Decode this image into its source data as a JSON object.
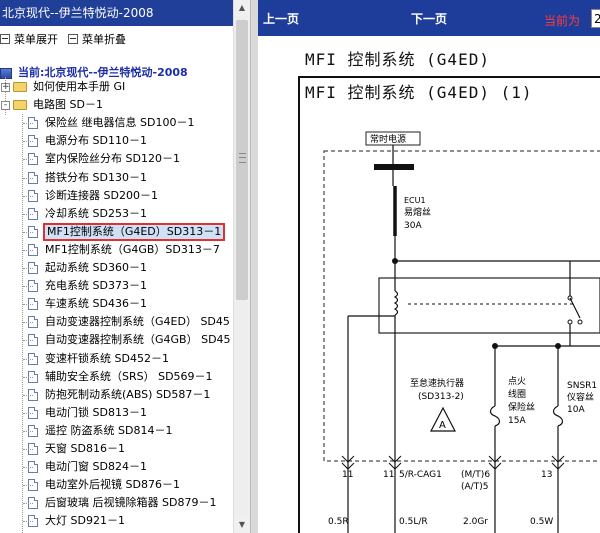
{
  "tree_panel": {
    "title": "北京现代--伊兰特悦动-2008",
    "tools": {
      "expand_label": "菜单展开",
      "collapse_label": "菜单折叠"
    },
    "root_label": "当前:北京现代--伊兰特悦动-2008",
    "items": [
      {
        "label": "如何使用本手册 GI",
        "kind": "folder",
        "state": "+"
      },
      {
        "label": "电路图 SD－1",
        "kind": "folder",
        "state": "-"
      },
      {
        "label": "保险丝 继电器信息 SD100－1",
        "kind": "doc"
      },
      {
        "label": "电源分布 SD110－1",
        "kind": "doc"
      },
      {
        "label": "室内保险丝分布 SD120－1",
        "kind": "doc"
      },
      {
        "label": "搭铁分布 SD130－1",
        "kind": "doc"
      },
      {
        "label": "诊断连接器 SD200－1",
        "kind": "doc"
      },
      {
        "label": "冷却系统 SD253－1",
        "kind": "doc"
      },
      {
        "label": "MF1控制系统（G4ED）SD313－1",
        "kind": "doc",
        "selected": true
      },
      {
        "label": "MF1控制系统（G4GB）SD313－7",
        "kind": "doc"
      },
      {
        "label": "起动系统 SD360－1",
        "kind": "doc"
      },
      {
        "label": "充电系统 SD373－1",
        "kind": "doc"
      },
      {
        "label": "车速系统 SD436－1",
        "kind": "doc"
      },
      {
        "label": "自动变速器控制系统（G4ED） SD45",
        "kind": "doc"
      },
      {
        "label": "自动变速器控制系统（G4GB） SD45",
        "kind": "doc"
      },
      {
        "label": "变速杆锁系统 SD452－1",
        "kind": "doc"
      },
      {
        "label": "辅助安全系统（SRS） SD569－1",
        "kind": "doc"
      },
      {
        "label": "防抱死制动系统(ABS) SD587－1",
        "kind": "doc"
      },
      {
        "label": "电动门锁 SD813－1",
        "kind": "doc"
      },
      {
        "label": "遥控 防盗系统 SD814－1",
        "kind": "doc"
      },
      {
        "label": "天窗 SD816－1",
        "kind": "doc"
      },
      {
        "label": "电动门窗 SD824－1",
        "kind": "doc"
      },
      {
        "label": "电动室外后视镜 SD876－1",
        "kind": "doc"
      },
      {
        "label": "后窗玻璃 后视镜除箱器 SD879－1",
        "kind": "doc"
      },
      {
        "label": "大灯 SD921－1",
        "kind": "doc"
      }
    ]
  },
  "nav": {
    "prev_label": "上一页",
    "next_label": "下一页",
    "current_label": "当前为",
    "page_value": "2"
  },
  "document": {
    "header": "MFI 控制系统 (G4ED)",
    "subtitle": "MFI 控制系统 (G4ED) (1)",
    "diagram": {
      "power_label": "常时电源",
      "fuse_main": [
        "ECU1",
        "易熔丝",
        "30A"
      ],
      "actuator_label": [
        "至怠速执行器",
        "(SD313-2)"
      ],
      "fuse_ign": [
        "点火",
        "线圈",
        "保险丝",
        "15A"
      ],
      "fuse_snsr": [
        "SNSR1",
        "仪容丝",
        "10A"
      ],
      "actuator_symbol": "A",
      "pins": [
        "11",
        "11",
        "5/R-CAG1",
        "(M/T)6",
        "(A/T)5",
        "13"
      ],
      "wires": [
        "0.5R",
        "0.5L/R",
        "2.0Gr",
        "0.5W"
      ]
    }
  },
  "colors": {
    "title_bar": "#1f3f99",
    "nav_bar": "#1e3d9a",
    "selection_border": "#e03131",
    "current_label": "#ff3b3b",
    "root_label": "#1a2ea8"
  }
}
